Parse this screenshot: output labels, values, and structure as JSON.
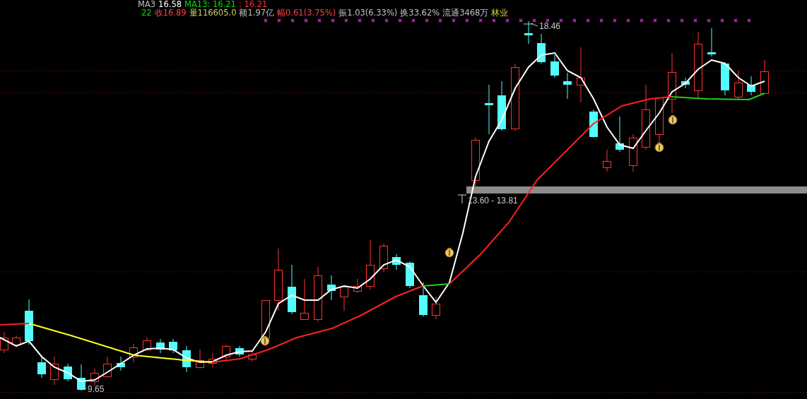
{
  "header": {
    "rows": [
      [
        {
          "text": "MA3",
          "color": "#c0c0c0"
        },
        {
          "text": "16.58",
          "color": "#ffffff"
        },
        {
          "text": "MA13: 16.21",
          "color": "#00e000"
        },
        {
          "text": ": 16.21",
          "color": "#ff3030"
        }
      ],
      [
        {
          "text": "22",
          "color": "#00e000"
        },
        {
          "text": "收16.89",
          "color": "#ff4040"
        },
        {
          "text": "量116605.0",
          "color": "#d0d060"
        },
        {
          "text": "额1.97亿",
          "color": "#c0c0c0"
        },
        {
          "text": "幅0.61(3.75%)",
          "color": "#ff4040"
        },
        {
          "text": "振1.03(6.33%)",
          "color": "#c0c0c0"
        },
        {
          "text": "换33.62%",
          "color": "#c0c0c0"
        },
        {
          "text": "流通3468万",
          "color": "#c0c0c0"
        },
        {
          "text": "林业",
          "color": "#d0d040"
        }
      ]
    ]
  },
  "chart": {
    "price_labels": [
      {
        "text": "18.46",
        "kind": "high"
      },
      {
        "text": "9.65",
        "kind": "low"
      },
      {
        "text": "13.60 - 13.81",
        "kind": "range"
      }
    ]
  }
}
